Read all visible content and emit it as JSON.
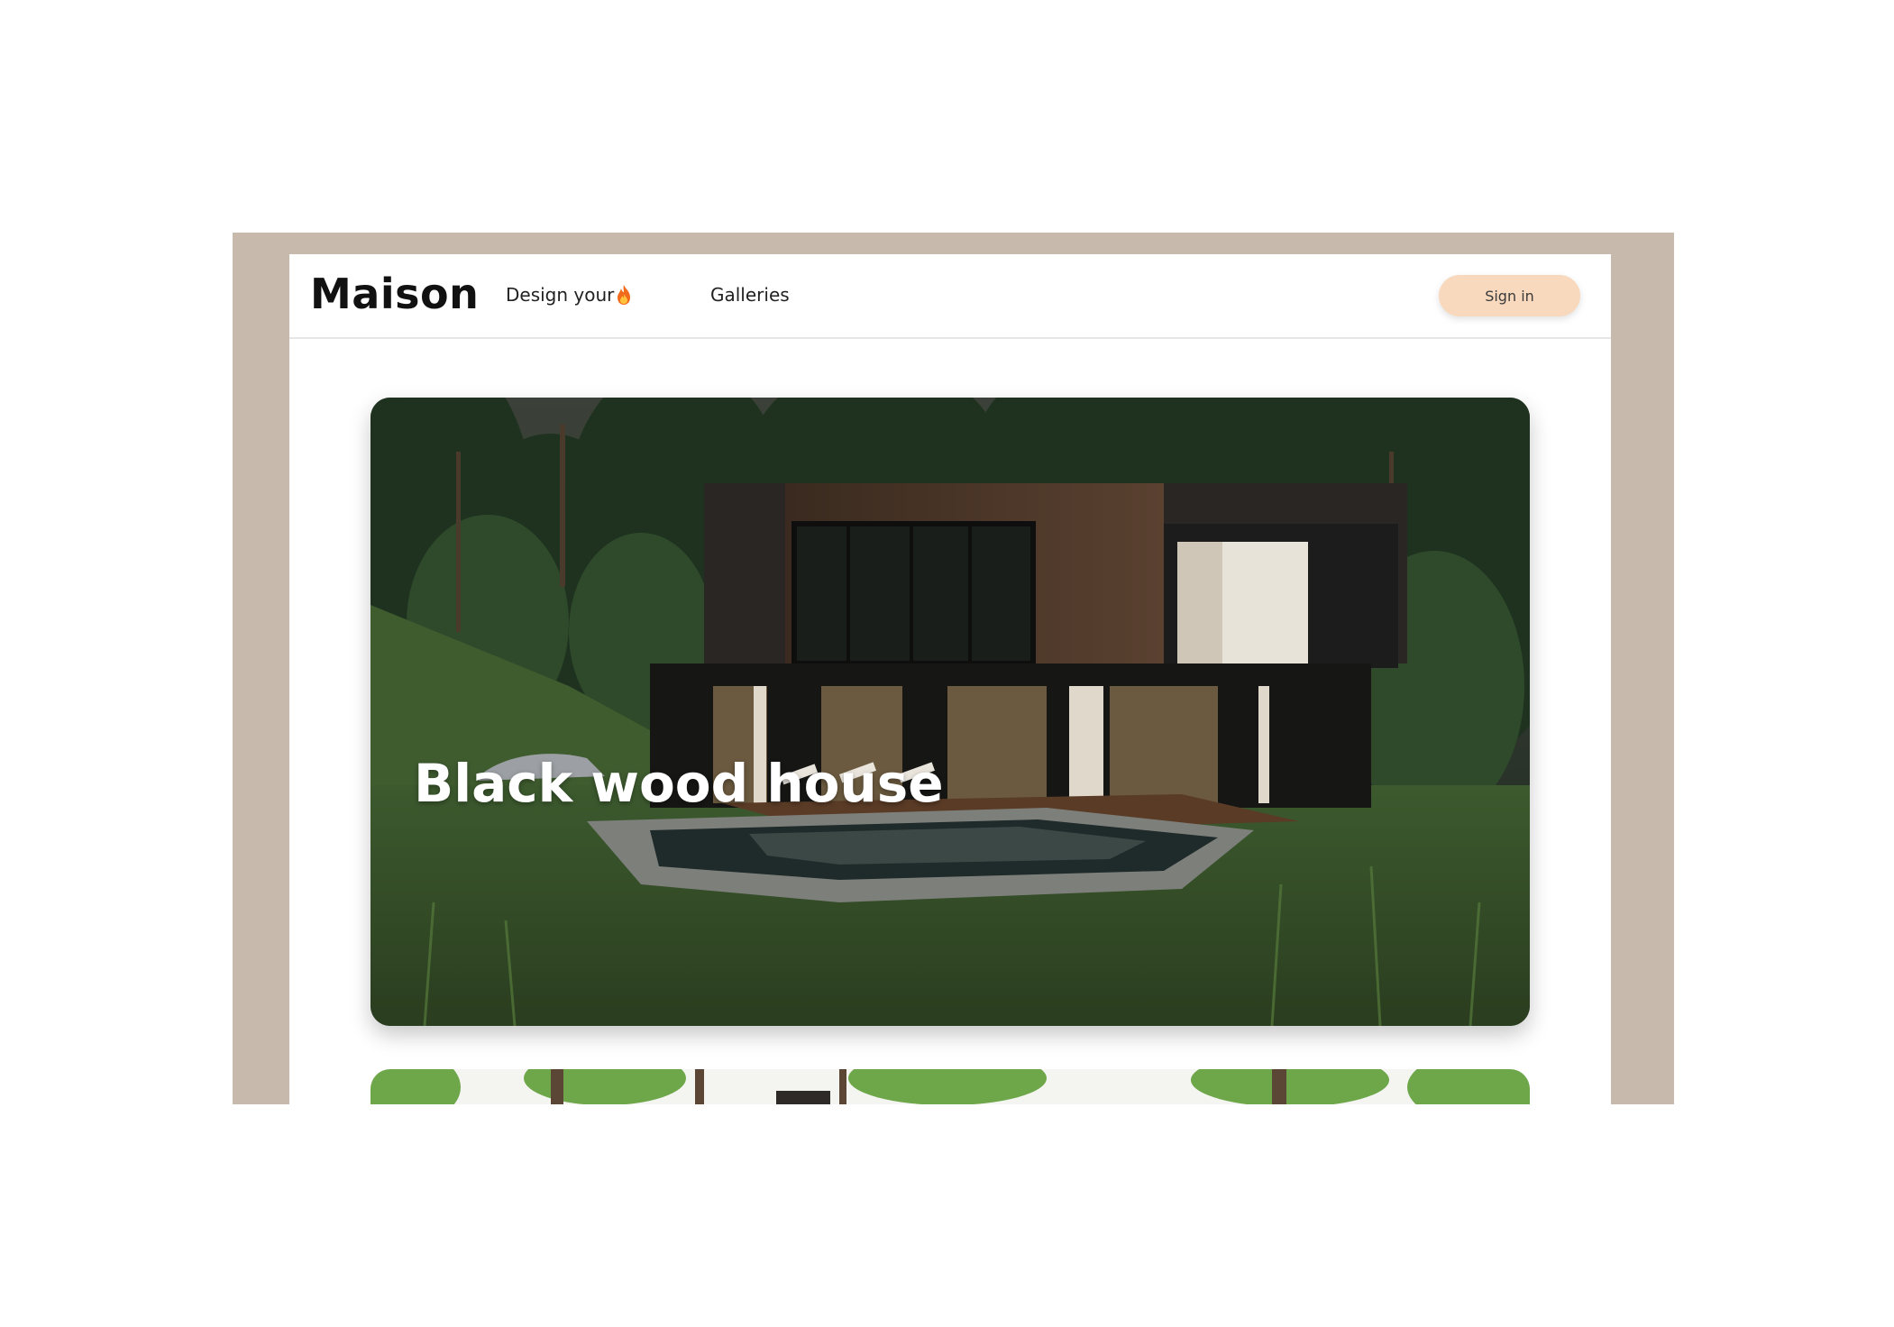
{
  "nav": {
    "brand": "Maison",
    "design_label": "Design your",
    "galleries_label": "Galleries",
    "signin_label": "Sign in"
  },
  "featured": {
    "title": "Black wood house"
  },
  "colors": {
    "frame": "#c7b9ac",
    "signin_bg": "#f8d9bd",
    "flame": "#f26b1d"
  },
  "icons": {
    "design_icon": "flame-icon"
  }
}
